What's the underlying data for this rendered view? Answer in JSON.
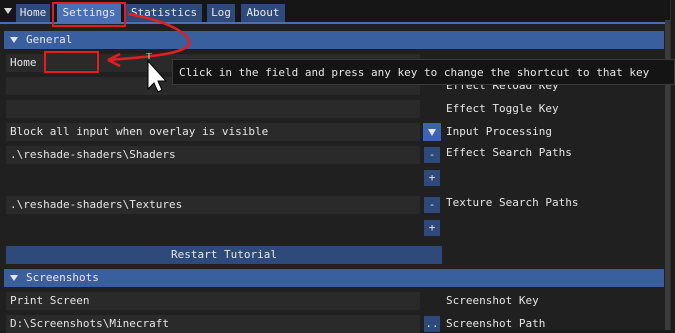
{
  "tabs": [
    {
      "label": "Home"
    },
    {
      "label": "Settings",
      "active": true
    },
    {
      "label": "Statistics"
    },
    {
      "label": "Log"
    },
    {
      "label": "About"
    }
  ],
  "general": {
    "header": "General",
    "shortcut_value": "Home",
    "rows": {
      "reload_label": "Effect Reload Key",
      "toggle_label": "Effect Toggle Key",
      "input_processing_value": "Block all input when overlay is visible",
      "input_processing_label": "Input Processing",
      "effect_paths_value": ".\\reshade-shaders\\Shaders",
      "effect_paths_label": "Effect Search Paths",
      "texture_paths_value": ".\\reshade-shaders\\Textures",
      "texture_paths_label": "Texture Search Paths"
    },
    "remove_label": "-",
    "add_label": "+",
    "restart_tutorial": "Restart Tutorial"
  },
  "screenshots": {
    "header": "Screenshots",
    "key_value": "Print Screen",
    "key_label": "Screenshot Key",
    "path_value": "D:\\Screenshots\\Minecraft",
    "path_label": "Screenshot Path",
    "browse_label": ".."
  },
  "tooltip": "Click in the field and press any key to change the shortcut to that key",
  "colors": {
    "accent": "#4a6fb5",
    "header": "#3a5f9e",
    "annotation": "#e02020"
  }
}
